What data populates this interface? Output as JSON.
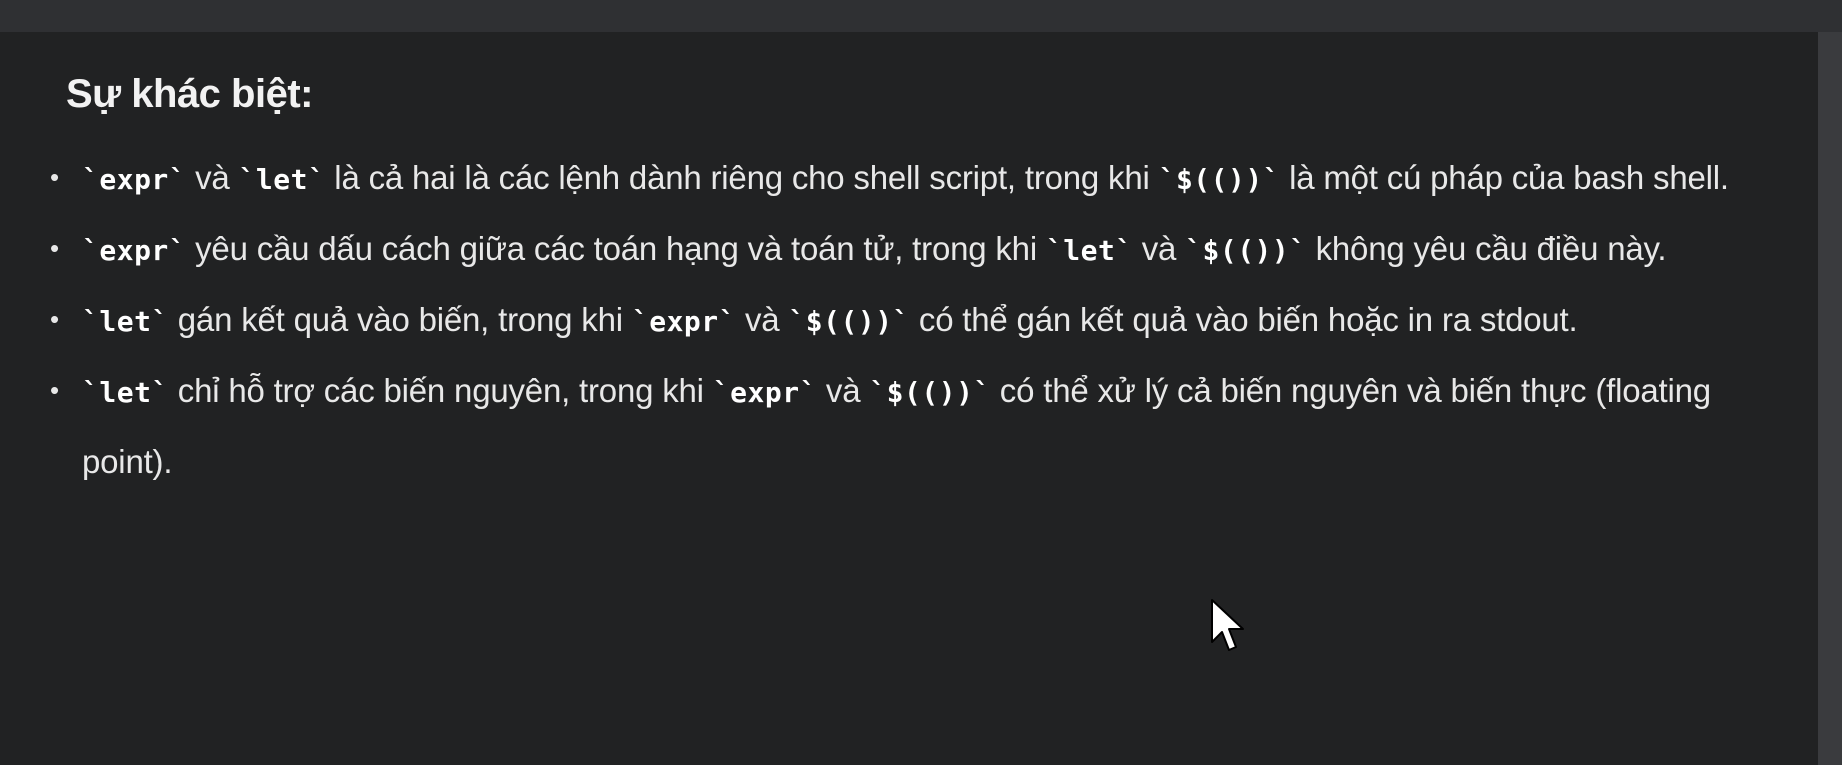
{
  "heading": "Sự khác biệt:",
  "items": [
    {
      "parts": [
        {
          "code": "`expr`"
        },
        {
          "text": " và "
        },
        {
          "code": "`let`"
        },
        {
          "text": " là cả hai là các lệnh dành riêng cho shell script, trong khi "
        },
        {
          "code": "`$(())`"
        },
        {
          "text": " là một cú pháp của bash shell."
        }
      ]
    },
    {
      "parts": [
        {
          "code": "`expr`"
        },
        {
          "text": " yêu cầu dấu cách giữa các toán hạng và toán tử, trong khi "
        },
        {
          "code": "`let`"
        },
        {
          "text": " và "
        },
        {
          "code": "`$(())`"
        },
        {
          "text": " không yêu cầu điều này."
        }
      ]
    },
    {
      "parts": [
        {
          "code": "`let`"
        },
        {
          "text": " gán kết quả vào biến, trong khi "
        },
        {
          "code": "`expr`"
        },
        {
          "text": " và "
        },
        {
          "code": "`$(())`"
        },
        {
          "text": " có thể gán kết quả vào biến hoặc in ra stdout."
        }
      ]
    },
    {
      "parts": [
        {
          "code": "`let`"
        },
        {
          "text": " chỉ hỗ trợ các biến nguyên, trong khi "
        },
        {
          "code": "`expr`"
        },
        {
          "text": " và "
        },
        {
          "code": "`$(())`"
        },
        {
          "text": " có thể xử lý cả biến nguyên và biến thực (floating point)."
        }
      ]
    }
  ],
  "icons": {
    "bullet": "bullet-dot-icon",
    "cursor": "mouse-pointer-icon"
  },
  "colors": {
    "background": "#212223",
    "text": "#e8e8e8",
    "code": "#ffffff"
  }
}
